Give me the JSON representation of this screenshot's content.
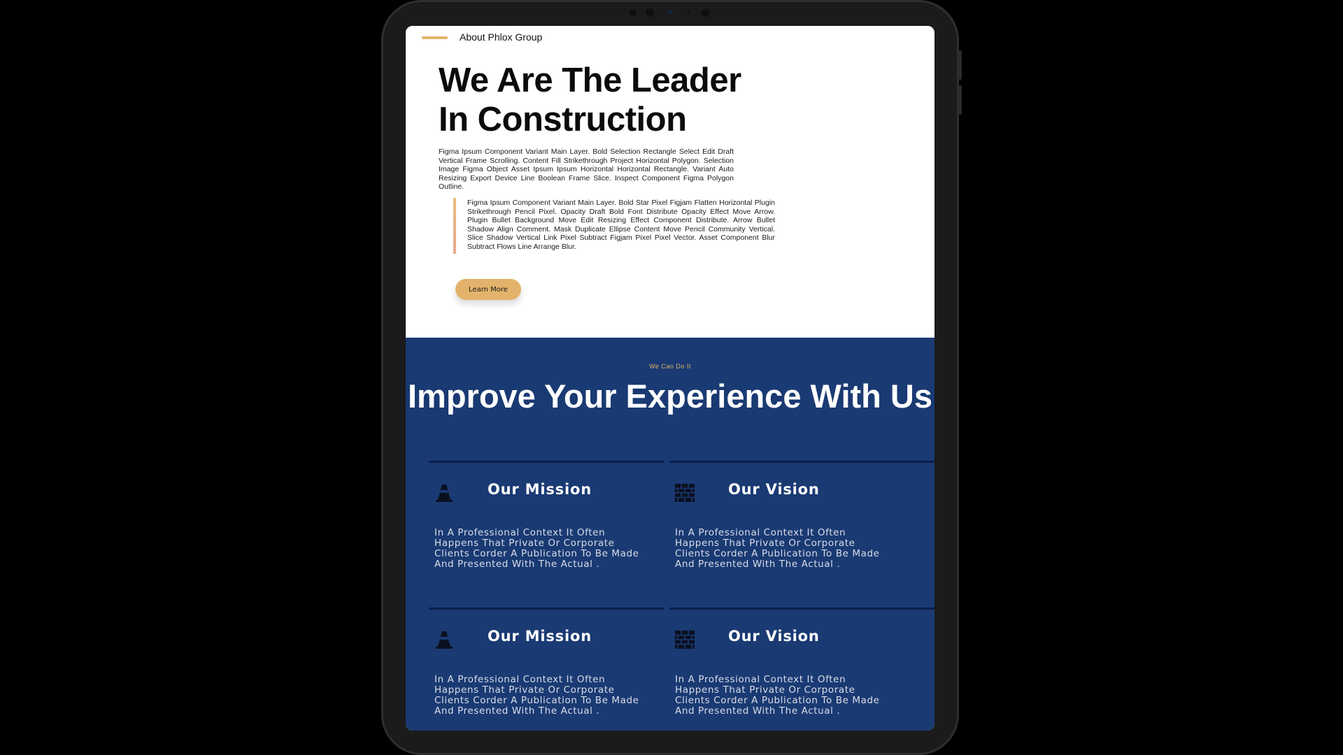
{
  "about": {
    "label": "About Phlox Group",
    "title": "We Are The Leader In Construction",
    "paragraph": "Figma Ipsum Component Variant Main Layer. Bold Selection Rectangle Select Edit Draft Vertical Frame Scrolling. Content Fill Strikethrough Project Horizontal Polygon. Selection Image Figma Object Asset Ipsum Ipsum Horizontal Horizontal Rectangle. Variant Auto Resizing Export Device Line Boolean Frame Slice. Inspect Component Figma Polygon Outline.",
    "quote": "Figma Ipsum Component Variant Main Layer. Bold Star Pixel Figjam Flatten Horizontal Plugin Strikethrough Pencil Pixel. Opacity Draft Bold Font Distribute Opacity Effect Move Arrow. Plugin Bullet Background Move Edit Resizing Effect Component Distribute. Arrow Bullet Shadow Align Comment. Mask Duplicate Ellipse Content Move Pencil Community Vertical. Slice Shadow Vertical Link Pixel Subtract Figjam Pixel Pixel Vector. Asset Component Blur Subtract Flows Line Arrange Blur.",
    "button_label": "Learn More"
  },
  "experience": {
    "eyebrow": "We Can Do It",
    "title": "Improve Your Experience With Us",
    "cards": [
      {
        "title": "Our Mission",
        "icon": "traffic-cone-icon",
        "text": "In A Professional Context It Often Happens That Private Or Corporate Clients Corder A Publication To Be Made And Presented With The Actual ."
      },
      {
        "title": "Our Vision",
        "icon": "brick-wall-icon",
        "text": "In A Professional Context It Often Happens That Private Or Corporate Clients Corder A Publication To Be Made And Presented With The Actual ."
      },
      {
        "title": "Our Mission",
        "icon": "traffic-cone-icon",
        "text": "In A Professional Context It Often Happens That Private Or Corporate Clients Corder A Publication To Be Made And Presented With The Actual ."
      },
      {
        "title": "Our Vision",
        "icon": "brick-wall-icon",
        "text": "In A Professional Context It Often Happens That Private Or Corporate Clients Corder A Publication To Be Made And Presented With The Actual ."
      }
    ]
  },
  "colors": {
    "accent": "#e3b36b",
    "navy": "#1a3a73",
    "divider": "#0b1f4d"
  }
}
